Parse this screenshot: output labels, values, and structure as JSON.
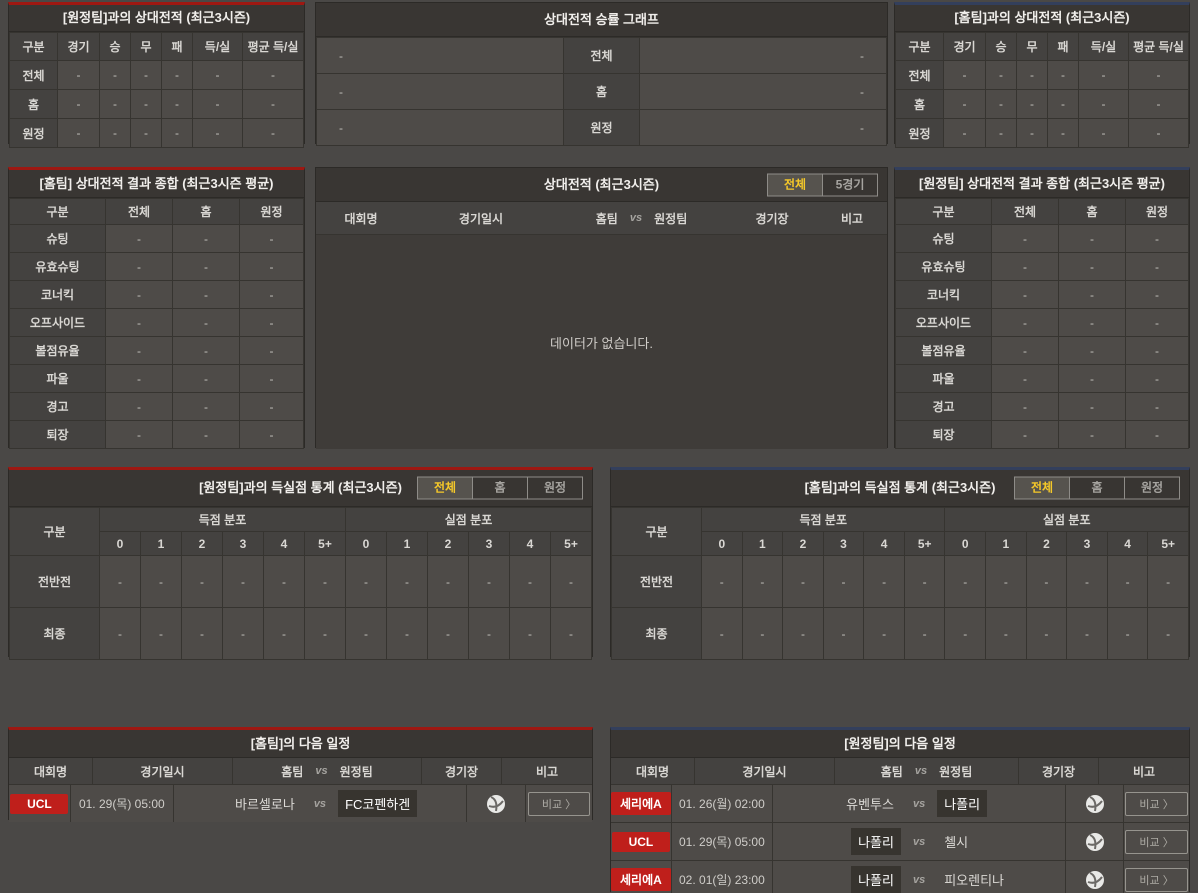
{
  "colors": {
    "accent_home_red": "#9e1812",
    "accent_away_blue": "#333f5c",
    "active_tab_text": "#f5c829",
    "league_badge_red": "#bf1f1b"
  },
  "h2h_away": {
    "title": "[원정팀]과의 상대전적 (최근3시즌)",
    "columns": [
      "구분",
      "경기",
      "승",
      "무",
      "패",
      "득/실",
      "평균 득/실"
    ],
    "rows": [
      {
        "label": "전체",
        "values": [
          "-",
          "-",
          "-",
          "-",
          "-",
          "-"
        ]
      },
      {
        "label": "홈",
        "values": [
          "-",
          "-",
          "-",
          "-",
          "-",
          "-"
        ]
      },
      {
        "label": "원정",
        "values": [
          "-",
          "-",
          "-",
          "-",
          "-",
          "-"
        ]
      }
    ]
  },
  "winrate": {
    "title": "상대전적 승률 그래프",
    "rows": [
      {
        "left": "-",
        "label": "전체",
        "right": "-"
      },
      {
        "left": "-",
        "label": "홈",
        "right": "-"
      },
      {
        "left": "-",
        "label": "원정",
        "right": "-"
      }
    ]
  },
  "h2h_home": {
    "title": "[홈팀]과의 상대전적 (최근3시즌)",
    "columns": [
      "구분",
      "경기",
      "승",
      "무",
      "패",
      "득/실",
      "평균 득/실"
    ],
    "rows": [
      {
        "label": "전체",
        "values": [
          "-",
          "-",
          "-",
          "-",
          "-",
          "-"
        ]
      },
      {
        "label": "홈",
        "values": [
          "-",
          "-",
          "-",
          "-",
          "-",
          "-"
        ]
      },
      {
        "label": "원정",
        "values": [
          "-",
          "-",
          "-",
          "-",
          "-",
          "-"
        ]
      }
    ]
  },
  "summary_home": {
    "title": "[홈팀] 상대전적 결과 종합 (최근3시즌 평균)",
    "columns": [
      "구분",
      "전체",
      "홈",
      "원정"
    ],
    "rows": [
      {
        "label": "슈팅",
        "values": [
          "-",
          "-",
          "-"
        ]
      },
      {
        "label": "유효슈팅",
        "values": [
          "-",
          "-",
          "-"
        ]
      },
      {
        "label": "코너킥",
        "values": [
          "-",
          "-",
          "-"
        ]
      },
      {
        "label": "오프사이드",
        "values": [
          "-",
          "-",
          "-"
        ]
      },
      {
        "label": "볼점유율",
        "values": [
          "-",
          "-",
          "-"
        ]
      },
      {
        "label": "파울",
        "values": [
          "-",
          "-",
          "-"
        ]
      },
      {
        "label": "경고",
        "values": [
          "-",
          "-",
          "-"
        ]
      },
      {
        "label": "퇴장",
        "values": [
          "-",
          "-",
          "-"
        ]
      }
    ]
  },
  "h2h_list": {
    "title": "상대전적 (최근3시즌)",
    "tabs": [
      "전체",
      "5경기"
    ],
    "header": {
      "league": "대회명",
      "datetime": "경기일시",
      "home": "홈팀",
      "vs": "vs",
      "away": "원정팀",
      "stadium": "경기장",
      "remark": "비고"
    },
    "empty": "데이터가 없습니다."
  },
  "summary_away": {
    "title": "[원정팀] 상대전적 결과 종합 (최근3시즌 평균)",
    "columns": [
      "구분",
      "전체",
      "홈",
      "원정"
    ],
    "rows": [
      {
        "label": "슈팅",
        "values": [
          "-",
          "-",
          "-"
        ]
      },
      {
        "label": "유효슈팅",
        "values": [
          "-",
          "-",
          "-"
        ]
      },
      {
        "label": "코너킥",
        "values": [
          "-",
          "-",
          "-"
        ]
      },
      {
        "label": "오프사이드",
        "values": [
          "-",
          "-",
          "-"
        ]
      },
      {
        "label": "볼점유율",
        "values": [
          "-",
          "-",
          "-"
        ]
      },
      {
        "label": "파울",
        "values": [
          "-",
          "-",
          "-"
        ]
      },
      {
        "label": "경고",
        "values": [
          "-",
          "-",
          "-"
        ]
      },
      {
        "label": "퇴장",
        "values": [
          "-",
          "-",
          "-"
        ]
      }
    ]
  },
  "goal_stats_away": {
    "title": "[원정팀]과의 득실점 통계 (최근3시즌)",
    "tabs": [
      "전체",
      "홈",
      "원정"
    ],
    "col_label": "구분",
    "groups": [
      "득점 분포",
      "실점 분포"
    ],
    "bins": [
      "0",
      "1",
      "2",
      "3",
      "4",
      "5+"
    ],
    "rows": [
      {
        "label": "전반전",
        "values": [
          "-",
          "-",
          "-",
          "-",
          "-",
          "-",
          "-",
          "-",
          "-",
          "-",
          "-",
          "-"
        ]
      },
      {
        "label": "최종",
        "values": [
          "-",
          "-",
          "-",
          "-",
          "-",
          "-",
          "-",
          "-",
          "-",
          "-",
          "-",
          "-"
        ]
      }
    ]
  },
  "goal_stats_home": {
    "title": "[홈팀]과의 득실점 통계 (최근3시즌)",
    "tabs": [
      "전체",
      "홈",
      "원정"
    ],
    "col_label": "구분",
    "groups": [
      "득점 분포",
      "실점 분포"
    ],
    "bins": [
      "0",
      "1",
      "2",
      "3",
      "4",
      "5+"
    ],
    "rows": [
      {
        "label": "전반전",
        "values": [
          "-",
          "-",
          "-",
          "-",
          "-",
          "-",
          "-",
          "-",
          "-",
          "-",
          "-",
          "-"
        ]
      },
      {
        "label": "최종",
        "values": [
          "-",
          "-",
          "-",
          "-",
          "-",
          "-",
          "-",
          "-",
          "-",
          "-",
          "-",
          "-"
        ]
      }
    ]
  },
  "schedule_home": {
    "title": "[홈팀]의 다음 일정",
    "header": {
      "league": "대회명",
      "datetime": "경기일시",
      "home": "홈팀",
      "vs": "vs",
      "away": "원정팀",
      "stadium": "경기장",
      "remark": "비고"
    },
    "compare_label": "비교 〉",
    "rows": [
      {
        "league": "UCL",
        "datetime": "01. 29(목) 05:00",
        "home": "바르셀로나",
        "vs": "vs",
        "away": "FC코펜하겐",
        "highlight": "hl-away"
      }
    ]
  },
  "schedule_away": {
    "title": "[원정팀]의 다음 일정",
    "header": {
      "league": "대회명",
      "datetime": "경기일시",
      "home": "홈팀",
      "vs": "vs",
      "away": "원정팀",
      "stadium": "경기장",
      "remark": "비고"
    },
    "compare_label": "비교 〉",
    "rows": [
      {
        "league": "세리에A",
        "datetime": "01. 26(월) 02:00",
        "home": "유벤투스",
        "vs": "vs",
        "away": "나폴리",
        "highlight": "hl-away"
      },
      {
        "league": "UCL",
        "datetime": "01. 29(목) 05:00",
        "home": "나폴리",
        "vs": "vs",
        "away": "첼시",
        "highlight": "hl-home"
      },
      {
        "league": "세리에A",
        "datetime": "02. 01(일) 23:00",
        "home": "나폴리",
        "vs": "vs",
        "away": "피오렌티나",
        "highlight": "hl-home"
      }
    ]
  }
}
